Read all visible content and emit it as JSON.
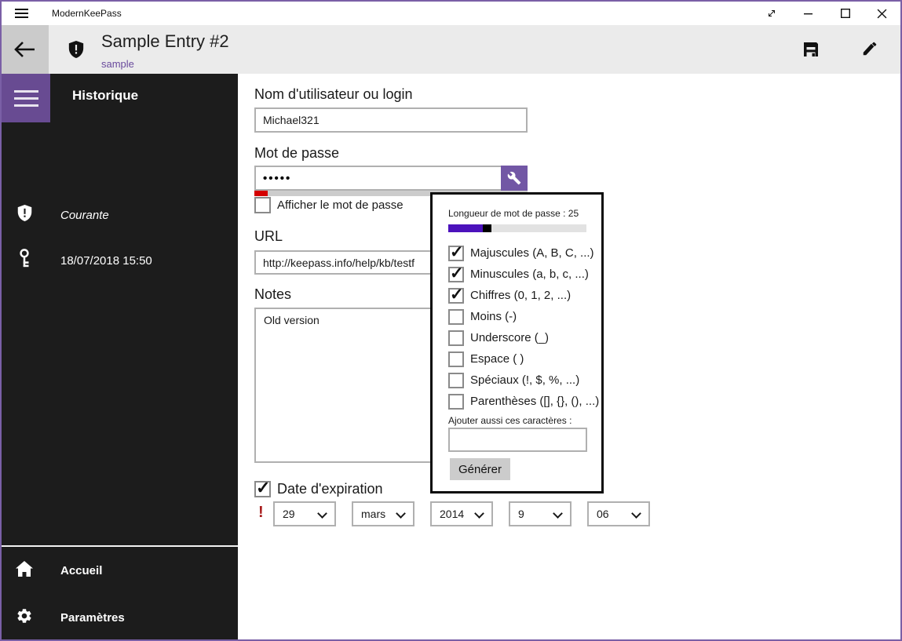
{
  "window": {
    "accent_color": "#7a5fa6"
  },
  "titlebar": {
    "app_title": "ModernKeePass"
  },
  "header": {
    "title": "Sample Entry #2",
    "subtitle": "sample"
  },
  "sidebar": {
    "heading": "Historique",
    "items": [
      {
        "icon": "shield-exclamation",
        "label": "Courante"
      },
      {
        "icon": "key",
        "label": "18/07/2018 15:50"
      }
    ],
    "footer_items": [
      {
        "icon": "home",
        "label": "Accueil"
      },
      {
        "icon": "gear",
        "label": "Paramètres"
      }
    ]
  },
  "form": {
    "username_label": "Nom d'utilisateur ou login",
    "username_value": "Michael321",
    "password_label": "Mot de passe",
    "password_value": "•••••",
    "password_strength_percent": 5,
    "strength_color": "#d40000",
    "show_password": {
      "label": "Afficher le mot de passe",
      "checked": false
    },
    "url_label": "URL",
    "url_value": "http://keepass.info/help/kb/testf",
    "notes_label": "Notes",
    "notes_value": "Old version",
    "expiration": {
      "label": "Date d'expiration",
      "checked": true,
      "warning_mark": "!",
      "day": "29",
      "month": "mars",
      "year": "2014",
      "hour": "9",
      "minute": "06"
    }
  },
  "popup": {
    "length_label": "Longueur de mot de passe : 25",
    "slider": {
      "percent": 25,
      "fill_color": "#4c12bc"
    },
    "options": [
      {
        "label": "Majuscules (A, B, C, ...)",
        "checked": true
      },
      {
        "label": "Minuscules (a, b, c, ...)",
        "checked": true
      },
      {
        "label": "Chiffres (0, 1, 2, ...)",
        "checked": true
      },
      {
        "label": "Moins (-)",
        "checked": false
      },
      {
        "label": "Underscore (_)",
        "checked": false
      },
      {
        "label": "Espace ( )",
        "checked": false
      },
      {
        "label": "Spéciaux (!, $, %, ...)",
        "checked": false
      },
      {
        "label": "Parenthèses ([], {}, (), ...)",
        "checked": false
      }
    ],
    "custom_chars_label": "Ajouter aussi ces caractères :",
    "custom_chars_value": "",
    "custom_chars_placeholder": "",
    "generate_label": "Générer"
  }
}
